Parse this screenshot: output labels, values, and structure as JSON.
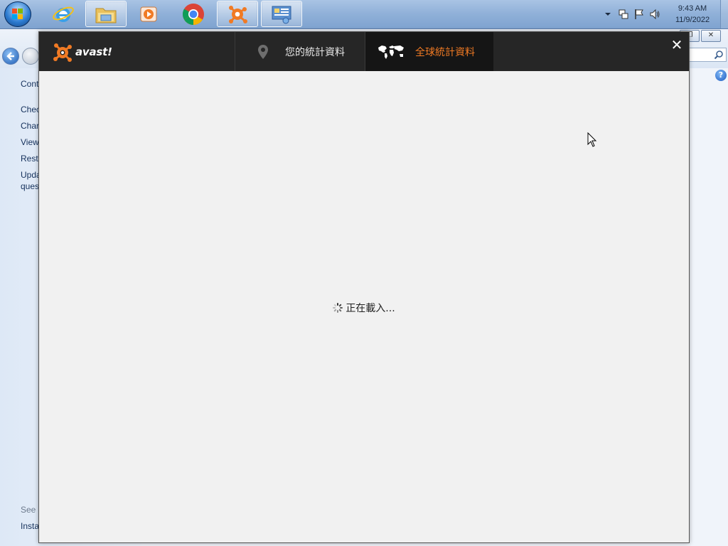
{
  "taskbar": {
    "buttons": [
      {
        "name": "internet-explorer"
      },
      {
        "name": "file-explorer"
      },
      {
        "name": "media-player"
      },
      {
        "name": "chrome"
      },
      {
        "name": "avast"
      },
      {
        "name": "control-panel"
      }
    ],
    "clock": {
      "time": "9:43 AM",
      "date": "11/9/2022"
    }
  },
  "background_window": {
    "sidebar_items": [
      "Cont",
      "Chec",
      "Char",
      "View",
      "Restc",
      "Upda",
      "ques"
    ],
    "sidebar_bottom": [
      "See a",
      "Insta"
    ],
    "caption_buttons": [
      "❐",
      "✕"
    ]
  },
  "avast": {
    "logo_text": "avast!",
    "tabs": [
      {
        "label": "您的統計資料",
        "icon": "map-pin-icon",
        "active": false
      },
      {
        "label": "全球統計資料",
        "icon": "world-map-icon",
        "active": true
      }
    ],
    "close_label": "✕",
    "loading_text": "正在載入...",
    "colors": {
      "header": "#262626",
      "active_tab": "#151515",
      "accent": "#f07a24",
      "body": "#f1f1f1"
    }
  }
}
